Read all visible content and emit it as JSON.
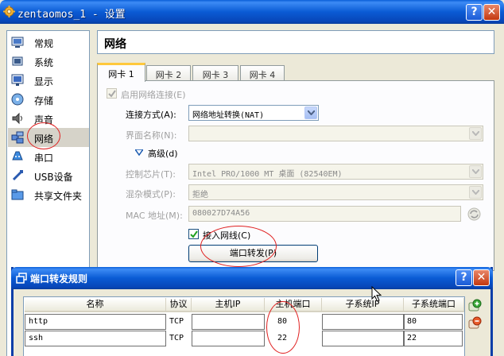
{
  "window": {
    "title": "zentaomos_1 - 设置",
    "help_label": "?",
    "close_label": "✕"
  },
  "sidebar": {
    "items": [
      {
        "label": "常规",
        "icon": "general-icon"
      },
      {
        "label": "系统",
        "icon": "system-icon"
      },
      {
        "label": "显示",
        "icon": "display-icon"
      },
      {
        "label": "存储",
        "icon": "storage-icon"
      },
      {
        "label": "声音",
        "icon": "audio-icon"
      },
      {
        "label": "网络",
        "icon": "network-icon",
        "selected": true
      },
      {
        "label": "串口",
        "icon": "serial-icon"
      },
      {
        "label": "USB设备",
        "icon": "usb-icon"
      },
      {
        "label": "共享文件夹",
        "icon": "shared-folder-icon"
      }
    ]
  },
  "page": {
    "title": "网络"
  },
  "tabs": [
    {
      "label": "网卡 1",
      "active": true
    },
    {
      "label": "网卡 2"
    },
    {
      "label": "网卡 3"
    },
    {
      "label": "网卡 4"
    }
  ],
  "adapter": {
    "enable_label": "启用网络连接(E)",
    "enabled": true,
    "attached_label": "连接方式(A):",
    "attached_value": "网络地址转换(NAT)",
    "name_label": "界面名称(N):",
    "name_value": "",
    "advanced_label": "高级(d)",
    "chip_label": "控制芯片(T):",
    "chip_value": "Intel PRO/1000 MT 桌面 (82540EM)",
    "promisc_label": "混杂模式(P):",
    "promisc_value": "拒绝",
    "mac_label": "MAC 地址(M):",
    "mac_value": "080027D74A56",
    "cable_label": "接入网线(C)",
    "cable_connected": true,
    "port_forward_label": "端口转发(P)"
  },
  "dialog": {
    "title": "端口转发规则",
    "help_label": "?",
    "close_label": "✕",
    "columns": [
      "名称",
      "协议",
      "主机IP",
      "主机端口",
      "子系统IP",
      "子系统端口"
    ],
    "rows": [
      [
        "http",
        "TCP",
        "",
        "80",
        "",
        "80"
      ],
      [
        "ssh",
        "TCP",
        "",
        "22",
        "",
        "22"
      ]
    ]
  },
  "colors": {
    "titlebar": "#0a5bd4",
    "annotation": "#e02020",
    "selection": "#d6d3c9",
    "tab_highlight": "#ffc83c"
  }
}
